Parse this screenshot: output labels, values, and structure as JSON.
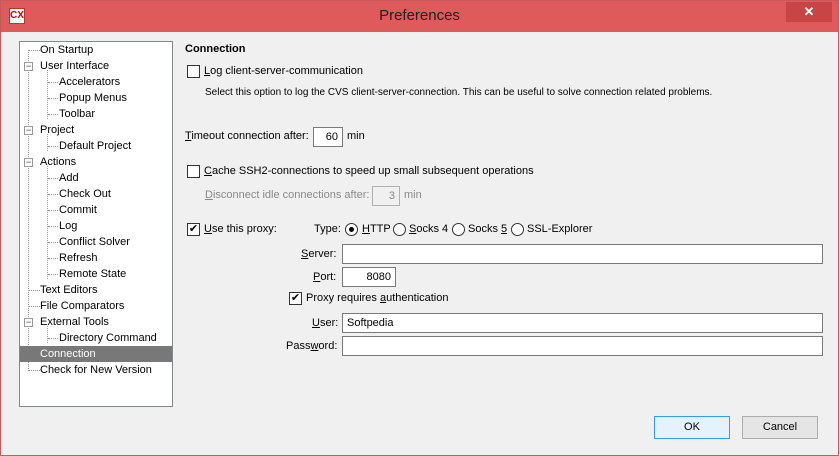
{
  "window": {
    "title": "Preferences",
    "close_glyph": "✕",
    "app_icon_glyph": "CX"
  },
  "tree": {
    "items": [
      {
        "label": "On Startup"
      },
      {
        "label": "User Interface"
      },
      {
        "label": "Accelerators"
      },
      {
        "label": "Popup Menus"
      },
      {
        "label": "Toolbar"
      },
      {
        "label": "Project"
      },
      {
        "label": "Default Project"
      },
      {
        "label": "Actions"
      },
      {
        "label": "Add"
      },
      {
        "label": "Check Out"
      },
      {
        "label": "Commit"
      },
      {
        "label": "Log"
      },
      {
        "label": "Conflict Solver"
      },
      {
        "label": "Refresh"
      },
      {
        "label": "Remote State"
      },
      {
        "label": "Text Editors"
      },
      {
        "label": "File Comparators"
      },
      {
        "label": "External Tools"
      },
      {
        "label": "Directory Command"
      },
      {
        "label": "Connection"
      },
      {
        "label": "Check for New Version"
      }
    ],
    "selected": "Connection",
    "expand_glyph": "−"
  },
  "connection": {
    "title": "Connection",
    "log": {
      "checked": false,
      "label_accel": "L",
      "label_rest": "og client-server-communication",
      "description": "Select this option to log the CVS client-server-connection. This can be useful to solve connection related problems."
    },
    "timeout": {
      "label_accel": "T",
      "label_rest": "imeout connection after:",
      "value": "60",
      "unit": "min"
    },
    "cache": {
      "checked": false,
      "label_accel": "C",
      "label_rest": "ache SSH2-connections to speed up small subsequent operations",
      "disconnect_accel": "D",
      "disconnect_rest": "isconnect idle connections after:",
      "disconnect_value": "3",
      "disconnect_unit": "min"
    },
    "proxy": {
      "checked": true,
      "check_glyph": "✔",
      "label_accel": "U",
      "label_rest": "se this proxy:",
      "type_label": "Type:",
      "types": [
        {
          "accel": "H",
          "rest": "TTP"
        },
        {
          "accel": "S",
          "rest": "ocks 4"
        },
        {
          "pre": "Socks ",
          "accel": "5",
          "rest": ""
        },
        {
          "pre": "SSL-Explorer",
          "accel": "",
          "rest": ""
        }
      ],
      "selected_type": "HTTP",
      "server_accel": "S",
      "server_rest": "erver:",
      "server_value": "",
      "port_accel": "P",
      "port_rest": "ort:",
      "port_value": "8080",
      "auth_checked": true,
      "auth_pre": "Proxy requires ",
      "auth_accel": "a",
      "auth_rest": "uthentication",
      "user_accel": "U",
      "user_rest": "ser:",
      "user_value": "Softpedia",
      "password_pre": "Pass",
      "password_accel": "w",
      "password_rest": "ord:",
      "password_value": ""
    }
  },
  "buttons": {
    "ok": "OK",
    "cancel": "Cancel"
  }
}
